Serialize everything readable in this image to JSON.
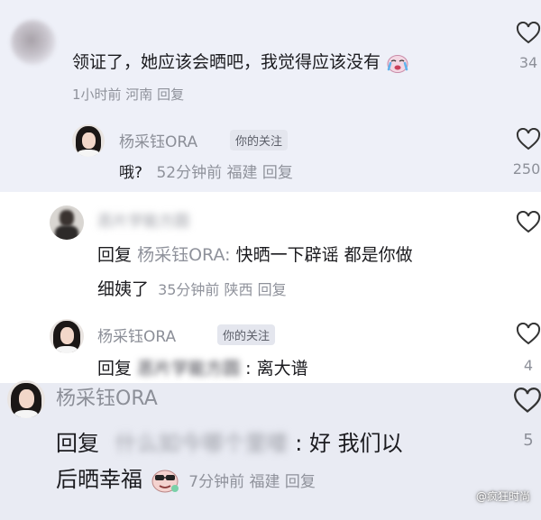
{
  "comments": [
    {
      "text": "领证了，她应该会晒吧，我觉得应该没有",
      "meta": "1小时前  河南  回复",
      "likes": "34"
    },
    {
      "username": "杨采钰ORA",
      "badge": "你的关注",
      "text_main": "哦?",
      "meta": "52分钟前 福建 回复",
      "likes": "250"
    },
    {
      "username": "恶片学能方圆",
      "text_prefix": "回复",
      "reply_to": "杨采钰ORA:",
      "text_line1": "快晒一下辟谣 都是你做",
      "text_line2": "细姨了",
      "meta": "35分钟前 陕西 回复",
      "likes": ""
    },
    {
      "username": "杨采钰ORA",
      "badge": "你的关注",
      "text_prefix": "回复",
      "reply_to_blurred": "恶片学能方圆",
      "text_main": ": 离大谱",
      "likes": "4"
    },
    {
      "username": "杨采钰ORA",
      "text_prefix": "回复",
      "reply_to_blurred": "什么如今哪个里喽",
      "text_line1": ":  好 我们以",
      "text_line2": "后晒幸福",
      "meta": "7分钟前 福建 回复",
      "likes": "5"
    }
  ],
  "watermark": "@疯狂时尚",
  "colors": {
    "band_light": "#eef0f8",
    "band_white": "#ffffff",
    "muted_text": "#8f929b"
  },
  "icons": [
    "heart-outline-icon",
    "crying-emoji-icon",
    "sunglasses-emoji-icon"
  ]
}
